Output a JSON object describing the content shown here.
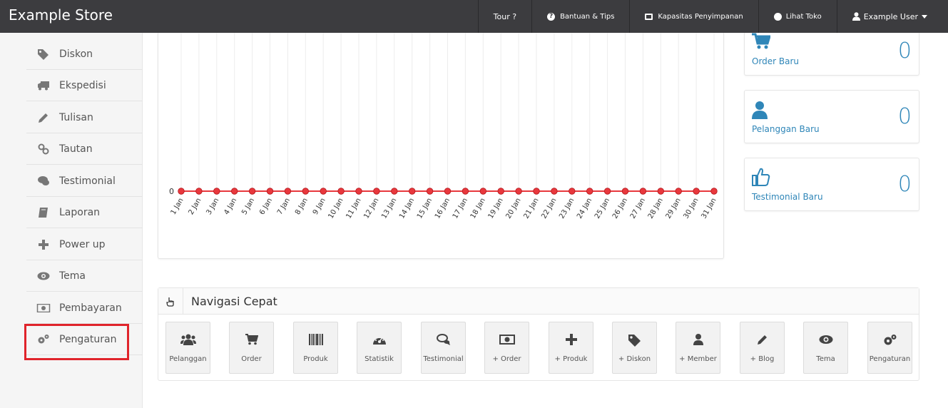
{
  "navbar": {
    "brand": "Example Store",
    "tour": "Tour ?",
    "help": "Bantuan & Tips",
    "storage": "Kapasitas Penyimpanan",
    "store": "Lihat Toko",
    "user": "Example User"
  },
  "sidebar": {
    "items": [
      {
        "label": "Diskon",
        "icon": "tags-icon"
      },
      {
        "label": "Ekspedisi",
        "icon": "truck-icon"
      },
      {
        "label": "Tulisan",
        "icon": "pencil-icon"
      },
      {
        "label": "Tautan",
        "icon": "link-icon"
      },
      {
        "label": "Testimonial",
        "icon": "comments-icon"
      },
      {
        "label": "Laporan",
        "icon": "book-icon"
      },
      {
        "label": "Power up",
        "icon": "plus-icon"
      },
      {
        "label": "Tema",
        "icon": "eye-icon"
      },
      {
        "label": "Pembayaran",
        "icon": "money-icon"
      },
      {
        "label": "Pengaturan",
        "icon": "gears-icon"
      }
    ],
    "highlight_color": "#e0242b"
  },
  "chart_data": {
    "type": "line",
    "categories": [
      "1 Jan",
      "2 Jan",
      "3 Jan",
      "4 Jan",
      "5 Jan",
      "6 Jan",
      "7 Jan",
      "8 Jan",
      "9 Jan",
      "10 Jan",
      "11 Jan",
      "12 Jan",
      "13 Jan",
      "14 Jan",
      "15 Jan",
      "16 Jan",
      "17 Jan",
      "18 Jan",
      "19 Jan",
      "20 Jan",
      "21 Jan",
      "22 Jan",
      "23 Jan",
      "24 Jan",
      "25 Jan",
      "26 Jan",
      "27 Jan",
      "28 Jan",
      "29 Jan",
      "30 Jan",
      "31 Jan"
    ],
    "series": [
      {
        "values": [
          0,
          0,
          0,
          0,
          0,
          0,
          0,
          0,
          0,
          0,
          0,
          0,
          0,
          0,
          0,
          0,
          0,
          0,
          0,
          0,
          0,
          0,
          0,
          0,
          0,
          0,
          0,
          0,
          0,
          0,
          0
        ],
        "color": "#e8383d"
      }
    ],
    "y_tick": "0",
    "grid": true
  },
  "stats": [
    {
      "label": "Order Baru",
      "value": "0",
      "icon": "cart-icon"
    },
    {
      "label": "Pelanggan Baru",
      "value": "0",
      "icon": "user-icon"
    },
    {
      "label": "Testimonial Baru",
      "value": "0",
      "icon": "thumbs-up-icon"
    }
  ],
  "quick_nav": {
    "title": "Navigasi Cepat",
    "buttons": [
      {
        "label": "Pelanggan",
        "icon": "users-icon"
      },
      {
        "label": "Order",
        "icon": "cart-icon"
      },
      {
        "label": "Produk",
        "icon": "barcode-icon"
      },
      {
        "label": "Statistik",
        "icon": "dashboard-icon"
      },
      {
        "label": "Testimonial",
        "icon": "comments-icon"
      },
      {
        "label": "+ Order",
        "icon": "money-icon"
      },
      {
        "label": "+ Produk",
        "icon": "plus-icon"
      },
      {
        "label": "+ Diskon",
        "icon": "tags-icon"
      },
      {
        "label": "+ Member",
        "icon": "user-icon"
      },
      {
        "label": "+ Blog",
        "icon": "pencil-icon"
      },
      {
        "label": "Tema",
        "icon": "eye-icon"
      },
      {
        "label": "Pengaturan",
        "icon": "gears-icon"
      }
    ]
  },
  "colors": {
    "navbar": "#3c3c3f",
    "accent": "#2f86b8"
  }
}
